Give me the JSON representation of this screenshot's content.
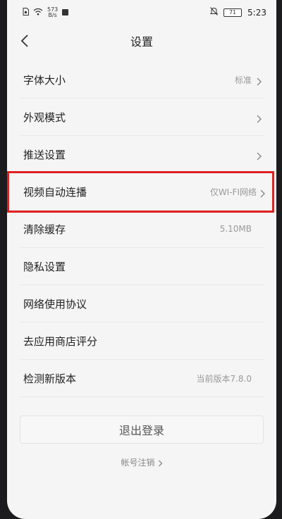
{
  "status_bar": {
    "net_speed_value": "573",
    "net_speed_unit": "B/s",
    "battery": "71",
    "time": "5:23"
  },
  "header": {
    "title": "设置"
  },
  "settings": {
    "items": [
      {
        "label": "字体大小",
        "value": "标准",
        "has_arrow": true
      },
      {
        "label": "外观模式",
        "value": "",
        "has_arrow": true
      },
      {
        "label": "推送设置",
        "value": "",
        "has_arrow": true
      },
      {
        "label": "视频自动连播",
        "value": "仅WI-FI网络",
        "has_arrow": true
      },
      {
        "label": "清除缓存",
        "value": "5.10MB",
        "has_arrow": false
      },
      {
        "label": "隐私设置",
        "value": "",
        "has_arrow": false
      },
      {
        "label": "网络使用协议",
        "value": "",
        "has_arrow": false
      },
      {
        "label": "去应用商店评分",
        "value": "",
        "has_arrow": false
      },
      {
        "label": "检测新版本",
        "value": "当前版本7.8.0",
        "has_arrow": false
      }
    ]
  },
  "footer": {
    "logout_label": "退出登录",
    "deactivate_label": "帐号注销"
  },
  "colors": {
    "highlight_border": "#e02020",
    "background": "#f5f5f5"
  }
}
